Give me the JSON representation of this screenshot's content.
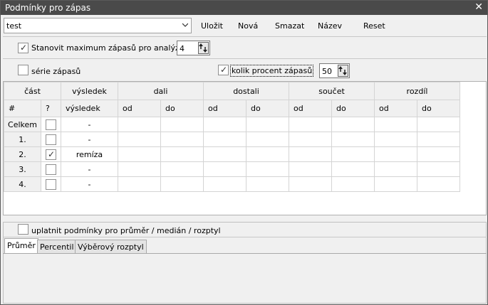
{
  "window": {
    "title": "Podmínky pro zápas"
  },
  "toolbar": {
    "preset_value": "test",
    "buttons": {
      "save": "Uložit",
      "new": "Nová",
      "delete": "Smazat",
      "name": "Název",
      "reset": "Reset"
    }
  },
  "options": {
    "max_games": {
      "label": "Stanovit maximum zápasů pro analýzu",
      "checked": true,
      "value": "4"
    },
    "series": {
      "label": "série zápasů",
      "checked": false
    },
    "percent": {
      "label": "kolik procent zápasů",
      "checked": true,
      "value": "50"
    }
  },
  "grid": {
    "headers": [
      "část",
      "výsledek",
      "dali",
      "dostali",
      "součet",
      "rozdíl"
    ],
    "subheaders": [
      "#",
      "?",
      "výsledek",
      "od",
      "do",
      "od",
      "do",
      "od",
      "do",
      "od",
      "do"
    ],
    "rows": [
      {
        "label": "Celkem",
        "checked": false,
        "result": "-"
      },
      {
        "label": "1.",
        "checked": false,
        "result": "-"
      },
      {
        "label": "2.",
        "checked": true,
        "result": "remíza"
      },
      {
        "label": "3.",
        "checked": false,
        "result": "-"
      },
      {
        "label": "4.",
        "checked": false,
        "result": "-"
      }
    ]
  },
  "bottom": {
    "apply_label": "uplatnit podmínky pro průměr / medián / rozptyl",
    "apply_checked": false,
    "tabs": [
      "Průměr",
      "Percentil",
      "Výběrový rozptyl"
    ],
    "active_tab": "Průměr"
  }
}
